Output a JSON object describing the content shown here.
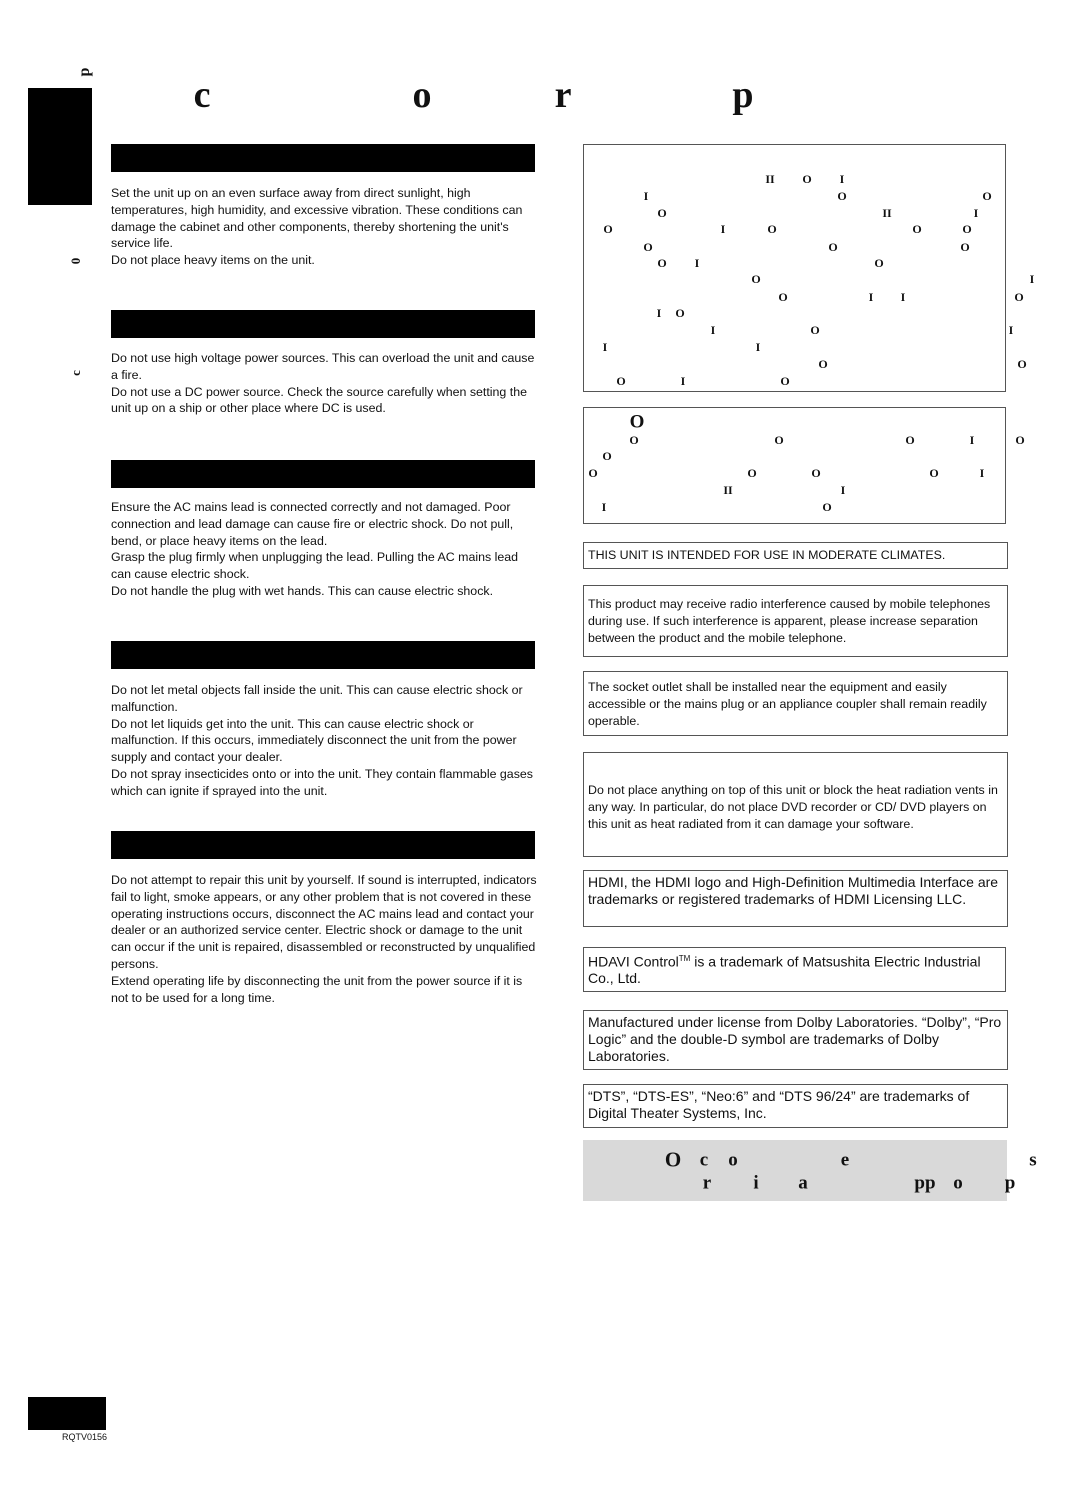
{
  "header": {
    "side_tab_glyph": "p",
    "title_glyphs": [
      "c",
      "o",
      "r",
      "p"
    ]
  },
  "margin_glyphs": [
    "0",
    "c"
  ],
  "left_sections": [
    {
      "paragraphs": [
        "Set the unit up on an even surface away from direct sunlight, high temperatures, high humidity, and excessive vibration. These conditions can damage the cabinet and other components, thereby shortening the unit's service life.",
        "Do not place heavy items on the unit."
      ]
    },
    {
      "paragraphs": [
        "Do not use high voltage power sources. This can overload the unit and cause a fire.",
        "Do not use a DC power source. Check the source carefully when setting the unit up on a ship or other place where DC is used."
      ]
    },
    {
      "paragraphs": [
        "Ensure the AC mains lead is connected correctly and not damaged. Poor connection and lead damage can cause fire or electric shock. Do not pull, bend, or place heavy items on the lead.",
        "Grasp the plug firmly when unplugging the lead. Pulling the AC mains lead can cause electric shock.",
        "Do not handle the plug with wet hands. This can cause electric shock."
      ]
    },
    {
      "paragraphs": [
        "Do not let metal objects fall inside the unit. This can cause electric shock or malfunction.",
        "Do not let liquids get into the unit. This can cause electric shock or malfunction. If this occurs, immediately disconnect the unit from the power supply and contact your dealer.",
        "Do not spray insecticides onto or into the unit. They contain flammable gases which can ignite if sprayed into the unit."
      ]
    },
    {
      "paragraphs": [
        "Do not attempt to repair this unit by yourself. If sound is interrupted, indicators fail to light, smoke appears, or any other problem that is not covered in these operating instructions occurs, disconnect the AC mains lead and contact your dealer or an authorized service center. Electric shock or damage to the unit can occur if the unit is repaired, disassembled or reconstructed by unqualified persons.",
        "Extend operating life by disconnecting the unit from the power source if it is not to be used for a long time."
      ]
    }
  ],
  "warning_box_glyphs": [
    "II",
    "O",
    "I",
    "I",
    "O",
    "O",
    "O",
    "II",
    "I",
    "O",
    "I",
    "O",
    "O",
    "O",
    "O",
    "O",
    "O",
    "O",
    "I",
    "O",
    "O",
    "I",
    "O",
    "I",
    "I",
    "O",
    "I",
    "O",
    "I",
    "O",
    "I",
    "I",
    "I",
    "O",
    "O",
    "O",
    "I",
    "O"
  ],
  "caution_box_glyphs": [
    "O",
    "O",
    "O",
    "O",
    "I",
    "O",
    "O",
    "O",
    "O",
    "O",
    "O",
    "I",
    "II",
    "I",
    "I",
    "O"
  ],
  "notices": {
    "climate": "THIS UNIT IS INTENDED FOR USE IN MODERATE CLIMATES.",
    "radio": "This product may receive radio interference caused by mobile telephones during use. If such interference is apparent, please increase separation between the product and the mobile telephone.",
    "socket": "The socket outlet shall be installed near the equipment and easily accessible or the mains plug or an appliance coupler shall remain readily operable.",
    "heat": "Do not place anything on top of this unit or block the heat radiation vents in any way. In particular, do not place DVD recorder or CD/ DVD players on this unit as heat radiated from it can damage your software.",
    "hdmi": "HDMI, the HDMI logo and High-Definition Multimedia Interface are trademarks or registered trademarks of HDMI Licensing LLC.",
    "hdavi_pre": "HDAVI Control",
    "hdavi_tm": "TM",
    "hdavi_post": " is a trademark of Matsushita Electric Industrial Co., Ltd.",
    "dolby": "Manufactured under license from Dolby Laboratories. “Dolby”, “Pro Logic” and the double-D symbol are trademarks of Dolby Laboratories.",
    "dts": "“DTS”, “DTS-ES”, “Neo:6” and “DTS 96/24” are trademarks of Digital Theater Systems, Inc."
  },
  "band_glyphs": [
    "O",
    "c",
    "o",
    "e",
    "s",
    "r",
    "i",
    "a",
    "pp",
    "o",
    "p"
  ],
  "footer": {
    "code": "RQTV0156"
  },
  "colors": {
    "bar": "#000000",
    "band": "#d9d9d9",
    "border": "#555555"
  }
}
